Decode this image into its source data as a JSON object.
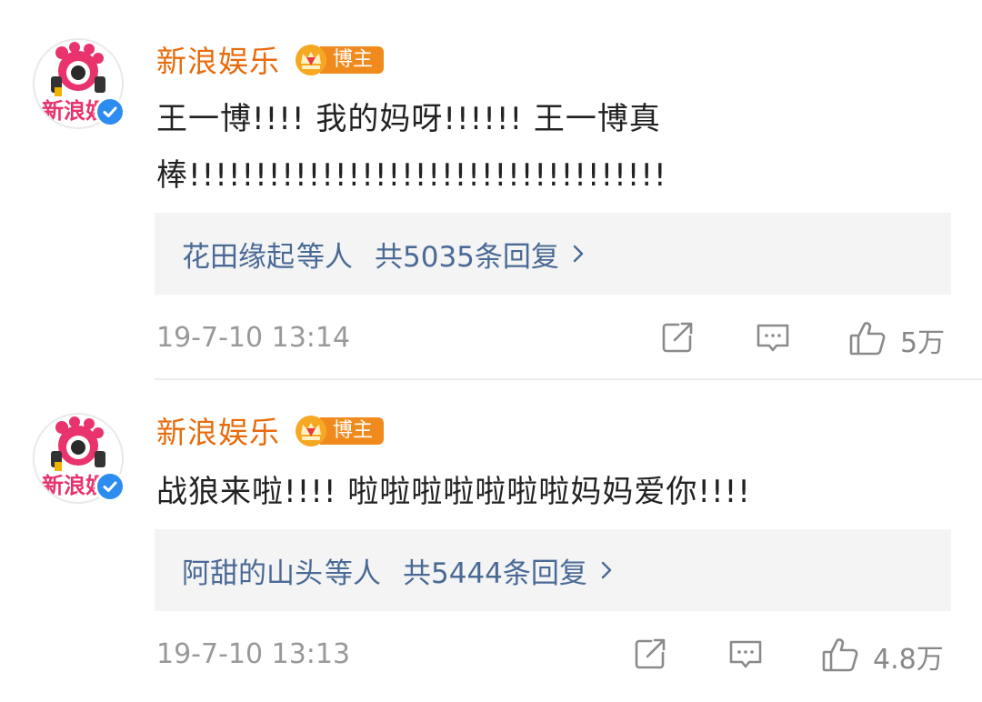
{
  "comments": [
    {
      "username": "新浪娱乐",
      "badge": "博主",
      "avatar_text": "新浪娱",
      "text": "王一博!!!! 我的妈呀!!!!!! 王一博真棒!!!!!!!!!!!!!!!!!!!!!!!!!!!!!!!!!!!!",
      "reply_users": "花田缘起",
      "reply_etc": "等人",
      "reply_total": "共5035条回复",
      "time": "19-7-10 13:14",
      "likes": "5万"
    },
    {
      "username": "新浪娱乐",
      "badge": "博主",
      "avatar_text": "新浪娱",
      "text": "战狼来啦!!!! 啦啦啦啦啦啦啦妈妈爱你!!!!",
      "reply_users": "阿甜的山头",
      "reply_etc": "等人",
      "reply_total": "共5444条回复",
      "time": "19-7-10 13:13",
      "likes": "4.8万"
    }
  ],
  "icons": {
    "verified": "verified-check-icon",
    "badge": "crown-icon",
    "chevron": "chevron-right-icon",
    "share": "share-icon",
    "comment": "comment-icon",
    "like": "thumbs-up-icon"
  },
  "colors": {
    "username": "#e86b0c",
    "badge_bg": "#f08a1d",
    "reply_link": "#4a6a96",
    "reply_bg": "#f4f4f4",
    "verified": "#2d8cf0",
    "meta": "#999999"
  }
}
